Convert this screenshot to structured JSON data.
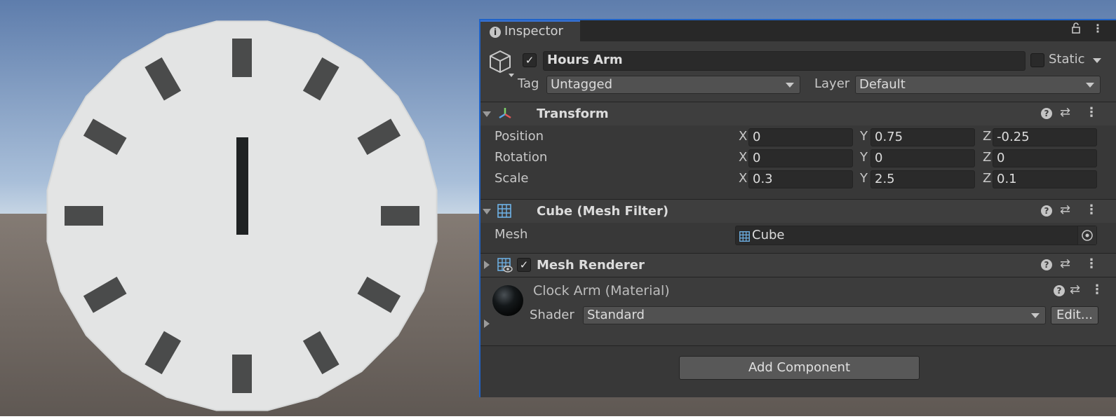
{
  "inspector": {
    "tab_label": "Inspector",
    "object": {
      "active": true,
      "name": "Hours Arm",
      "static_label": "Static",
      "static": false,
      "tag_label": "Tag",
      "tag_value": "Untagged",
      "layer_label": "Layer",
      "layer_value": "Default"
    },
    "transform": {
      "title": "Transform",
      "position_label": "Position",
      "rotation_label": "Rotation",
      "scale_label": "Scale",
      "axis_x": "X",
      "axis_y": "Y",
      "axis_z": "Z",
      "position": {
        "x": "0",
        "y": "0.75",
        "z": "-0.25"
      },
      "rotation": {
        "x": "0",
        "y": "0",
        "z": "0"
      },
      "scale": {
        "x": "0.3",
        "y": "2.5",
        "z": "0.1"
      }
    },
    "mesh_filter": {
      "title": "Cube (Mesh Filter)",
      "mesh_label": "Mesh",
      "mesh_value": "Cube"
    },
    "mesh_renderer": {
      "title": "Mesh Renderer",
      "enabled": true
    },
    "material": {
      "title": "Clock Arm (Material)",
      "shader_label": "Shader",
      "shader_value": "Standard",
      "edit_label": "Edit..."
    },
    "add_component_label": "Add Component"
  },
  "colors": {
    "sky_top": "#5f7fae",
    "sky_bottom": "#b7cbe0",
    "ground": "#6b625c",
    "clock_face": "#e4e5e5",
    "hour_marker": "#4a4b4b",
    "clock_arm": "#1f2223",
    "panel_bg": "#383838",
    "panel_border": "#1f63c9"
  },
  "icons": {
    "tab": "info-icon",
    "object": "cube-icon",
    "transform": "transform-axes-icon",
    "mesh_filter": "mesh-grid-icon",
    "mesh_renderer": "mesh-renderer-icon",
    "material": "sphere-icon"
  }
}
